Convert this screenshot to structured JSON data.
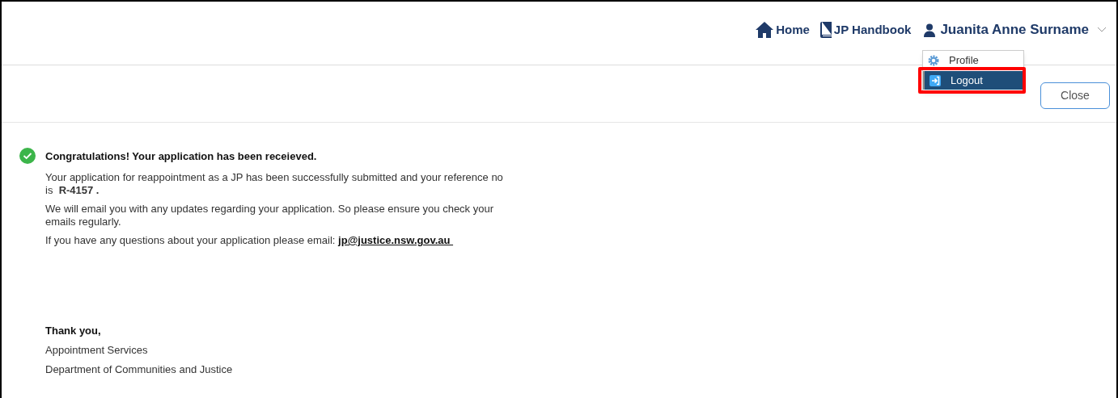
{
  "nav": {
    "links": [
      {
        "label": "Home",
        "kind": "home"
      },
      {
        "label": "JP Handbook",
        "kind": "book"
      }
    ],
    "user": {
      "name": "Juanita Anne Surname",
      "expanded": true
    }
  },
  "user_menu": {
    "items": [
      {
        "label": "Profile",
        "kind": "gear",
        "selected": false,
        "highlighted": false
      },
      {
        "label": "Logout",
        "kind": "logout",
        "selected": true,
        "highlighted": true
      }
    ]
  },
  "toolbar": {
    "close_button": "Close"
  },
  "message": {
    "title": "Congratulations! Your application has been receieved.",
    "paragraphs": [
      "Your application for reappointment as a JP has been successfully submitted and your reference no is  **R-4157 .**",
      "We will email you with any updates regarding your application. So please ensure you check your emails regularly."
    ],
    "contact_text": "If you have any questions about your application please email:",
    "contact_email": "jp@justice.nsw.gov.au "
  },
  "signature": {
    "closing": "Thank you,",
    "lines": [
      "Appointment Services",
      "Department of Communities and Justice"
    ]
  }
}
